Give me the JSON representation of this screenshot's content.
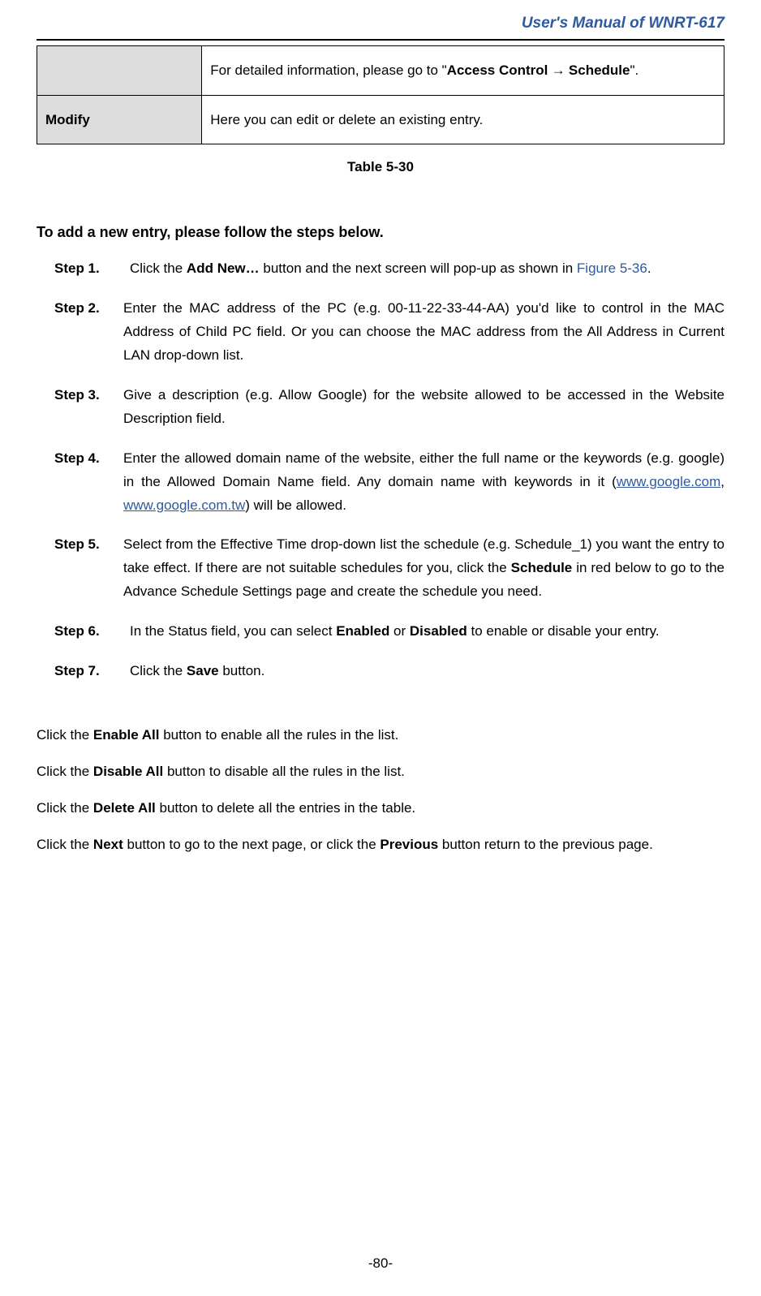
{
  "header": {
    "title": "User's Manual of WNRT-617"
  },
  "table": {
    "row1_content_pre": "For detailed information, please go to \"",
    "row1_content_bold1": "Access Control",
    "row1_content_arrow": " → ",
    "row1_content_bold2": "Schedule",
    "row1_content_post": "\".",
    "row2_label": "Modify",
    "row2_content": "Here you can edit or delete an existing entry."
  },
  "table_caption": "Table 5-30",
  "section_title": "To add a new entry, please follow the steps below.",
  "steps": {
    "s1": {
      "label": "Step 1.",
      "t1": "Click the ",
      "b1": "Add New…",
      "t2": " button and the next screen will pop-up as shown in ",
      "link1": "Figure 5-36",
      "t3": "."
    },
    "s2": {
      "label": "Step 2.",
      "t1": "Enter the MAC address of the PC (e.g. 00-11-22-33-44-AA) you'd like to control in the MAC Address of Child PC field. Or you can choose the MAC address from the All Address in Current LAN drop-down list."
    },
    "s3": {
      "label": "Step 3.",
      "t1": "Give a description (e.g. Allow Google) for the website allowed to be accessed in the Website Description field."
    },
    "s4": {
      "label": "Step 4.",
      "t1": "Enter the allowed domain name of the website, either the full name or the keywords (e.g. google) in the Allowed Domain Name field. Any domain name with keywords in it (",
      "link1": "www.google.com",
      "t2": ", ",
      "link2": "www.google.com.tw",
      "t3": ") will be allowed."
    },
    "s5": {
      "label": "Step 5.",
      "t1": "Select from the Effective Time drop-down list the schedule (e.g. Schedule_1) you want the entry to take effect. If there are not suitable schedules for you, click the ",
      "b1": "Schedule",
      "t2": " in red below to go to the Advance Schedule Settings page and create the schedule you need."
    },
    "s6": {
      "label": "Step 6.",
      "t1": "In the Status field, you can select ",
      "b1": "Enabled",
      "t2": " or ",
      "b2": "Disabled",
      "t3": " to enable or disable your entry."
    },
    "s7": {
      "label": "Step 7.",
      "t1": "Click the ",
      "b1": "Save",
      "t2": " button."
    }
  },
  "buttons": {
    "l1": {
      "t1": "Click the ",
      "b1": "Enable All",
      "t2": " button to enable all the rules in the list."
    },
    "l2": {
      "t1": "Click the ",
      "b1": "Disable All",
      "t2": " button to disable all the rules in the list."
    },
    "l3": {
      "t1": "Click the ",
      "b1": "Delete All",
      "t2": " button to delete all the entries in the table."
    },
    "l4": {
      "t1": "Click the ",
      "b1": "Next",
      "t2": " button to go to the next page, or click the ",
      "b2": "Previous",
      "t3": " button return to the previous page."
    }
  },
  "footer": "-80-"
}
